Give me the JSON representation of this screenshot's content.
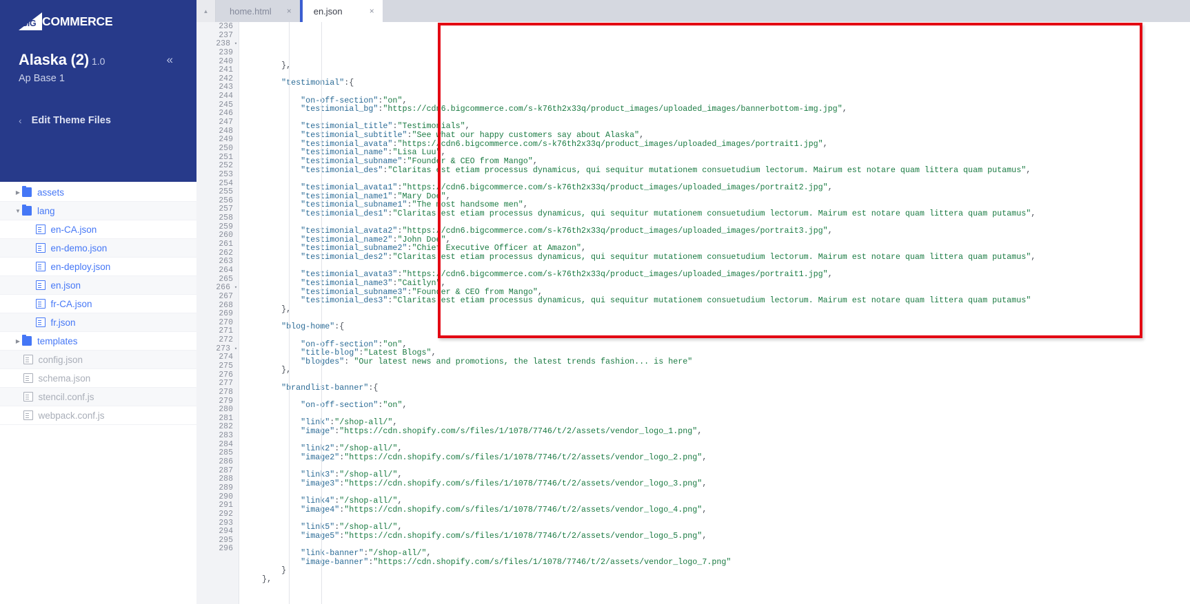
{
  "sidebar": {
    "logo": {
      "mark_text": "BIG",
      "word_text": "COMMERCE",
      "icon": "bigcommerce-logo-icon"
    },
    "theme_name": "Alaska (2)",
    "theme_version": "1.0",
    "theme_subtitle": "Ap Base 1",
    "collapse_icon": "«",
    "back_chevron_icon": "‹",
    "edit_theme_label": "Edit Theme Files",
    "tree": [
      {
        "label": "assets",
        "type": "folder",
        "caret": "▶",
        "depth": 0,
        "state": "collapsed",
        "muted": false
      },
      {
        "label": "lang",
        "type": "folder",
        "caret": "▼",
        "depth": 0,
        "state": "expanded",
        "muted": false
      },
      {
        "label": "en-CA.json",
        "type": "file",
        "caret": "",
        "depth": 1,
        "state": "",
        "muted": false
      },
      {
        "label": "en-demo.json",
        "type": "file",
        "caret": "",
        "depth": 1,
        "state": "",
        "muted": false
      },
      {
        "label": "en-deploy.json",
        "type": "file",
        "caret": "",
        "depth": 1,
        "state": "",
        "muted": false
      },
      {
        "label": "en.json",
        "type": "file",
        "caret": "",
        "depth": 1,
        "state": "",
        "muted": false
      },
      {
        "label": "fr-CA.json",
        "type": "file",
        "caret": "",
        "depth": 1,
        "state": "",
        "muted": false
      },
      {
        "label": "fr.json",
        "type": "file",
        "caret": "",
        "depth": 1,
        "state": "",
        "muted": false
      },
      {
        "label": "templates",
        "type": "folder",
        "caret": "▶",
        "depth": 0,
        "state": "collapsed",
        "muted": false
      },
      {
        "label": "config.json",
        "type": "file",
        "caret": "",
        "depth": 0,
        "state": "",
        "muted": true
      },
      {
        "label": "schema.json",
        "type": "file",
        "caret": "",
        "depth": 0,
        "state": "",
        "muted": true
      },
      {
        "label": "stencil.conf.js",
        "type": "file",
        "caret": "",
        "depth": 0,
        "state": "",
        "muted": true
      },
      {
        "label": "webpack.conf.js",
        "type": "file",
        "caret": "",
        "depth": 0,
        "state": "",
        "muted": true
      }
    ]
  },
  "tabs": [
    {
      "label": "home.html",
      "active": false,
      "close_icon": "×"
    },
    {
      "label": "en.json",
      "active": true,
      "close_icon": "×"
    }
  ],
  "gutter_toggle_icon": "▲",
  "editor": {
    "first_line_number": 236,
    "folded_lines": [
      238,
      266,
      273
    ],
    "lines": [
      {
        "n": 236,
        "text": "        },",
        "indent": 0
      },
      {
        "n": 237,
        "text": "",
        "indent": 0
      },
      {
        "n": 238,
        "text": "        \"testimonial\":{",
        "indent": 0
      },
      {
        "n": 239,
        "text": "",
        "indent": 0
      },
      {
        "n": 240,
        "text": "            \"on-off-section\":\"on\",",
        "indent": 0
      },
      {
        "n": 241,
        "text": "            \"testimonial_bg\":\"https://cdn6.bigcommerce.com/s-k76th2x33q/product_images/uploaded_images/bannerbottom-img.jpg\",",
        "indent": 0
      },
      {
        "n": 242,
        "text": "",
        "indent": 0
      },
      {
        "n": 243,
        "text": "            \"testimonial_title\":\"Testimonials\",",
        "indent": 0
      },
      {
        "n": 244,
        "text": "            \"testimonial_subtitle\":\"See what our happy customers say about Alaska\",",
        "indent": 0
      },
      {
        "n": 245,
        "text": "            \"testimonial_avata\":\"https://cdn6.bigcommerce.com/s-k76th2x33q/product_images/uploaded_images/portrait1.jpg\",",
        "indent": 0
      },
      {
        "n": 246,
        "text": "            \"testimonial_name\":\"Lisa Luu\",",
        "indent": 0
      },
      {
        "n": 247,
        "text": "            \"testimonial_subname\":\"Founder & CEO from Mango\",",
        "indent": 0
      },
      {
        "n": 248,
        "text": "            \"testimonial_des\":\"Claritas est etiam processus dynamicus, qui sequitur mutationem consuetudium lectorum. Mairum est notare quam littera quam putamus\",",
        "indent": 0
      },
      {
        "n": 249,
        "text": "",
        "indent": 0
      },
      {
        "n": 250,
        "text": "            \"testimonial_avata1\":\"https://cdn6.bigcommerce.com/s-k76th2x33q/product_images/uploaded_images/portrait2.jpg\",",
        "indent": 0
      },
      {
        "n": 251,
        "text": "            \"testimonial_name1\":\"Mary Doe\",",
        "indent": 0
      },
      {
        "n": 252,
        "text": "            \"testimonial_subname1\":\"The most handsome men\",",
        "indent": 0
      },
      {
        "n": 253,
        "text": "            \"testimonial_des1\":\"Claritas est etiam processus dynamicus, qui sequitur mutationem consuetudium lectorum. Mairum est notare quam littera quam putamus\",",
        "indent": 0
      },
      {
        "n": 254,
        "text": "",
        "indent": 0
      },
      {
        "n": 255,
        "text": "            \"testimonial_avata2\":\"https://cdn6.bigcommerce.com/s-k76th2x33q/product_images/uploaded_images/portrait3.jpg\",",
        "indent": 0
      },
      {
        "n": 256,
        "text": "            \"testimonial_name2\":\"John Doe\",",
        "indent": 0
      },
      {
        "n": 257,
        "text": "            \"testimonial_subname2\":\"Chief Executive Officer at Amazon\",",
        "indent": 0
      },
      {
        "n": 258,
        "text": "            \"testimonial_des2\":\"Claritas est etiam processus dynamicus, qui sequitur mutationem consuetudium lectorum. Mairum est notare quam littera quam putamus\",",
        "indent": 0
      },
      {
        "n": 259,
        "text": "",
        "indent": 0
      },
      {
        "n": 260,
        "text": "            \"testimonial_avata3\":\"https://cdn6.bigcommerce.com/s-k76th2x33q/product_images/uploaded_images/portrait1.jpg\",",
        "indent": 0
      },
      {
        "n": 261,
        "text": "            \"testimonial_name3\":\"Caitlyn\",",
        "indent": 0
      },
      {
        "n": 262,
        "text": "            \"testimonial_subname3\":\"Founder & CEO from Mango\",",
        "indent": 0
      },
      {
        "n": 263,
        "text": "            \"testimonial_des3\":\"Claritas est etiam processus dynamicus, qui sequitur mutationem consuetudium lectorum. Mairum est notare quam littera quam putamus\"",
        "indent": 0
      },
      {
        "n": 264,
        "text": "        },",
        "indent": 0
      },
      {
        "n": 265,
        "text": "",
        "indent": 0
      },
      {
        "n": 266,
        "text": "        \"blog-home\":{",
        "indent": 0
      },
      {
        "n": 267,
        "text": "",
        "indent": 0
      },
      {
        "n": 268,
        "text": "            \"on-off-section\":\"on\",",
        "indent": 0
      },
      {
        "n": 269,
        "text": "            \"title-blog\":\"Latest Blogs\",",
        "indent": 0
      },
      {
        "n": 270,
        "text": "            \"blogdes\": \"Our latest news and promotions, the latest trends fashion... is here\"",
        "indent": 0
      },
      {
        "n": 271,
        "text": "        },",
        "indent": 0
      },
      {
        "n": 272,
        "text": "",
        "indent": 0
      },
      {
        "n": 273,
        "text": "        \"brandlist-banner\":{",
        "indent": 0
      },
      {
        "n": 274,
        "text": "",
        "indent": 0
      },
      {
        "n": 275,
        "text": "            \"on-off-section\":\"on\",",
        "indent": 0
      },
      {
        "n": 276,
        "text": "",
        "indent": 0
      },
      {
        "n": 277,
        "text": "            \"link\":\"/shop-all/\",",
        "indent": 0
      },
      {
        "n": 278,
        "text": "            \"image\":\"https://cdn.shopify.com/s/files/1/1078/7746/t/2/assets/vendor_logo_1.png\",",
        "indent": 0
      },
      {
        "n": 279,
        "text": "",
        "indent": 0
      },
      {
        "n": 280,
        "text": "            \"link2\":\"/shop-all/\",",
        "indent": 0
      },
      {
        "n": 281,
        "text": "            \"image2\":\"https://cdn.shopify.com/s/files/1/1078/7746/t/2/assets/vendor_logo_2.png\",",
        "indent": 0
      },
      {
        "n": 282,
        "text": "",
        "indent": 0
      },
      {
        "n": 283,
        "text": "            \"link3\":\"/shop-all/\",",
        "indent": 0
      },
      {
        "n": 284,
        "text": "            \"image3\":\"https://cdn.shopify.com/s/files/1/1078/7746/t/2/assets/vendor_logo_3.png\",",
        "indent": 0
      },
      {
        "n": 285,
        "text": "",
        "indent": 0
      },
      {
        "n": 286,
        "text": "            \"link4\":\"/shop-all/\",",
        "indent": 0
      },
      {
        "n": 287,
        "text": "            \"image4\":\"https://cdn.shopify.com/s/files/1/1078/7746/t/2/assets/vendor_logo_4.png\",",
        "indent": 0
      },
      {
        "n": 288,
        "text": "",
        "indent": 0
      },
      {
        "n": 289,
        "text": "            \"link5\":\"/shop-all/\",",
        "indent": 0
      },
      {
        "n": 290,
        "text": "            \"image5\":\"https://cdn.shopify.com/s/files/1/1078/7746/t/2/assets/vendor_logo_5.png\",",
        "indent": 0
      },
      {
        "n": 291,
        "text": "",
        "indent": 0
      },
      {
        "n": 292,
        "text": "            \"link-banner\":\"/shop-all/\",",
        "indent": 0
      },
      {
        "n": 293,
        "text": "            \"image-banner\":\"https://cdn.shopify.com/s/files/1/1078/7746/t/2/assets/vendor_logo_7.png\"",
        "indent": 0
      },
      {
        "n": 294,
        "text": "        }",
        "indent": 0
      },
      {
        "n": 295,
        "text": "    },",
        "indent": 0
      },
      {
        "n": 296,
        "text": "",
        "indent": 0
      }
    ]
  },
  "annotation": {
    "shape": "rectangle",
    "color": "#e30613",
    "covers_lines": "238-271"
  },
  "colors": {
    "sidebar_bg": "#273a8a",
    "accent": "#4577f6",
    "tab_active_bar": "#3b5ed1",
    "string": "#1a7a42",
    "key": "#2b6b96",
    "annotation": "#e30613"
  }
}
